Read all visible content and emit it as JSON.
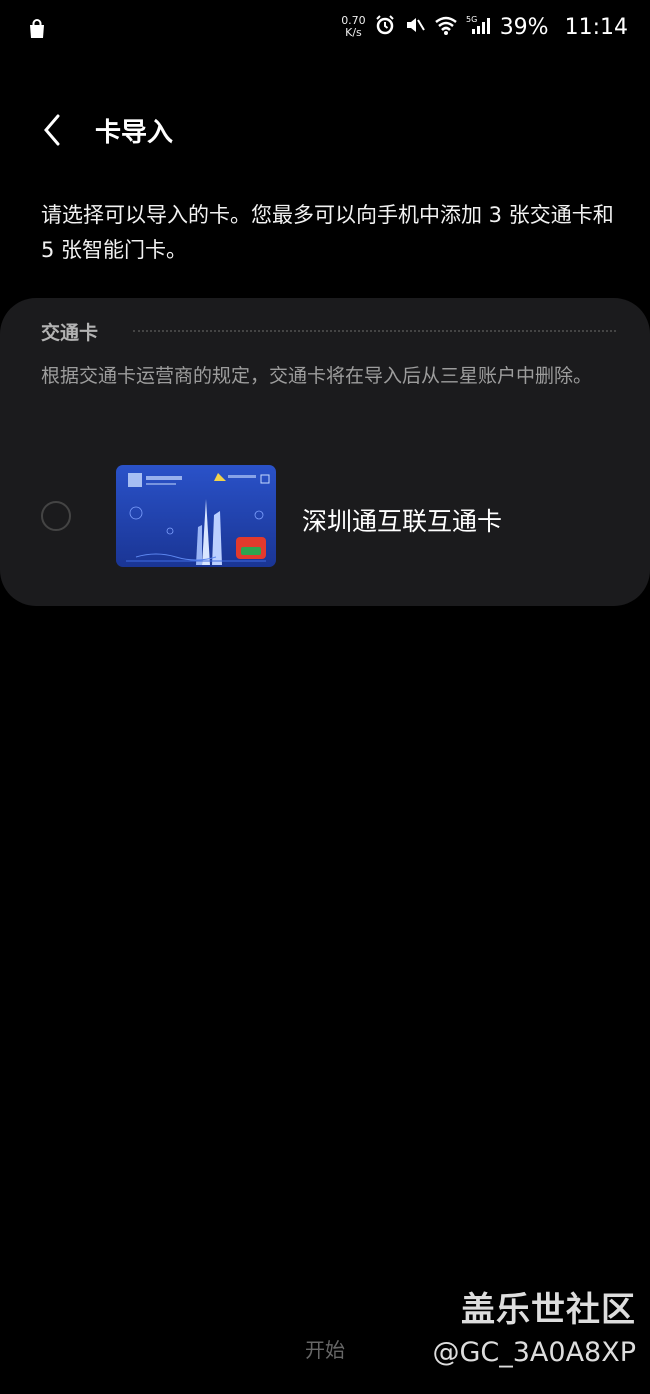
{
  "status_bar": {
    "speed_value": "0.70",
    "speed_unit": "K/s",
    "battery": "39%",
    "time": "11:14",
    "icons": [
      "shopping-bag-icon",
      "alarm-icon",
      "mute-icon",
      "wifi-icon",
      "signal-5g-icon"
    ]
  },
  "header": {
    "title": "卡导入"
  },
  "intro": "请选择可以导入的卡。您最多可以向手机中添加 3 张交通卡和 5 张智能门卡。",
  "section": {
    "title": "交通卡",
    "description": "根据交通卡运营商的规定，交通卡将在导入后从三星账户中删除。",
    "cards": [
      {
        "name": "深圳通互联互通卡",
        "selected": false
      }
    ]
  },
  "bottom": {
    "start_label": "开始"
  },
  "watermark": {
    "title": "盖乐世社区",
    "user": "@GC_3A0A8XP"
  },
  "colors": {
    "background": "#000000",
    "panel": "#1b1b1d",
    "card_blue": "#1f3fa6"
  }
}
